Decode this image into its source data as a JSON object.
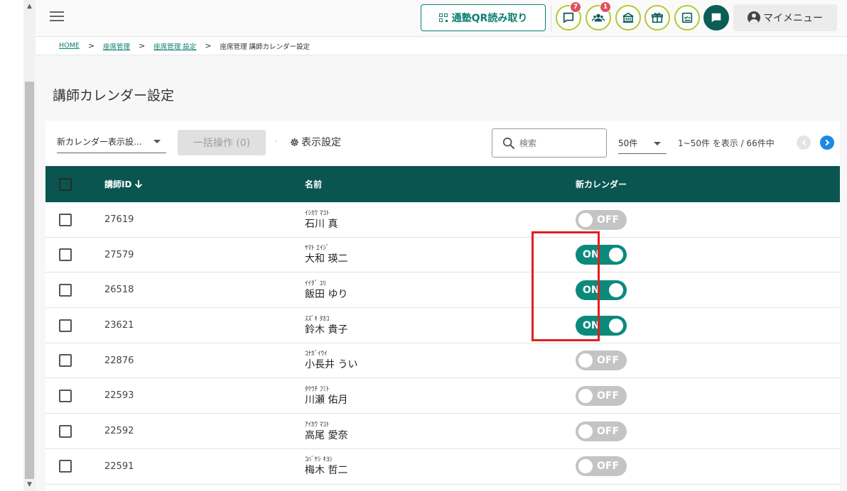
{
  "header": {
    "qr_label": "通塾QR読み取り",
    "icons": [
      {
        "name": "chat-icon",
        "badge": "7"
      },
      {
        "name": "people-icon",
        "badge": "1"
      },
      {
        "name": "school-icon",
        "badge": ""
      },
      {
        "name": "gift-icon",
        "badge": ""
      },
      {
        "name": "checklist-icon",
        "badge": ""
      },
      {
        "name": "message-icon",
        "badge": ""
      }
    ],
    "mymenu_label": "マイメニュー"
  },
  "breadcrumb": {
    "items": [
      "HOME",
      "座席管理",
      "座席管理 設定"
    ],
    "current": "座席管理 講師カレンダー設定",
    "sep": ">"
  },
  "page_title": "講師カレンダー設定",
  "toolbar": {
    "dropdown_label": "新カレンダー表示設...",
    "bulk_label": "一括操作 (0)",
    "dot": "·",
    "display_settings_label": "表示設定",
    "search_placeholder": "検索",
    "per_page": "50件",
    "page_info": "1~50件 を表示 / 66件中"
  },
  "table": {
    "headers": {
      "id": "講師ID",
      "name": "名前",
      "calendar": "新カレンダー"
    },
    "rows": [
      {
        "id": "27619",
        "kana": "ｲｼｶﾜ ﾏｺﾄ",
        "name": "石川 真",
        "state": "OFF"
      },
      {
        "id": "27579",
        "kana": "ﾔﾏﾄ ｴｲｼﾞ",
        "name": "大和 瑛二",
        "state": "ON"
      },
      {
        "id": "26518",
        "kana": "ｲｲﾀﾞ ﾕﾘ",
        "name": "飯田 ゆり",
        "state": "ON"
      },
      {
        "id": "23621",
        "kana": "ｽｽﾞｷ ﾀｶｺ",
        "name": "鈴木 貴子",
        "state": "ON"
      },
      {
        "id": "22876",
        "kana": "ｺﾅｶﾞｲｳｲ",
        "name": "小長井 うい",
        "state": "OFF"
      },
      {
        "id": "22593",
        "kana": "ﾀｹｳﾁ ﾌﾐﾄ",
        "name": "川瀬 佑月",
        "state": "OFF"
      },
      {
        "id": "22592",
        "kana": "ｱｲｶﾜ ﾏｺﾄ",
        "name": "高尾 愛奈",
        "state": "OFF"
      },
      {
        "id": "22591",
        "kana": "ｺﾊﾞﾔｼ ｷﾖｼ",
        "name": "梅木 哲二",
        "state": "OFF"
      }
    ]
  },
  "colors": {
    "accent": "#0b7f72",
    "header_bg": "#0b5550",
    "toggle_on": "#0b8a7c",
    "toggle_off": "#c4c4c4",
    "highlight": "#e02020"
  }
}
